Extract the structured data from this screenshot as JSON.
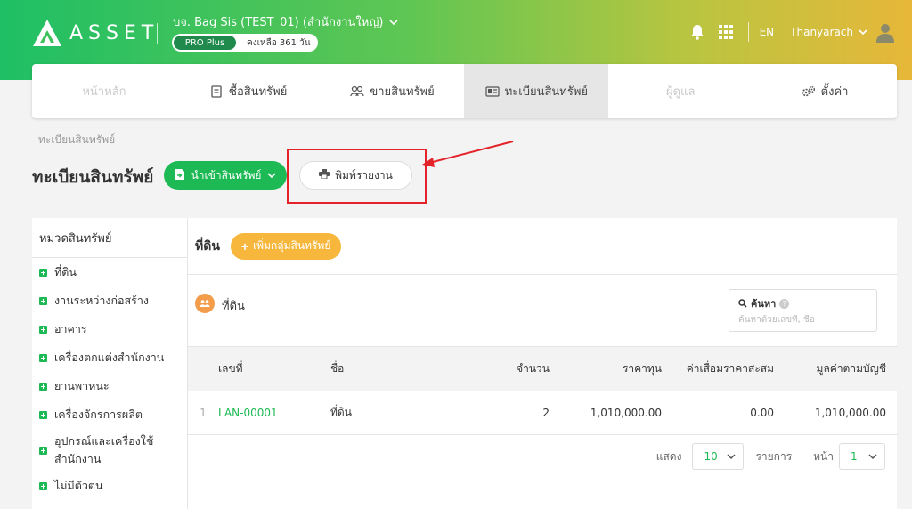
{
  "header": {
    "logo_text": "ASSET",
    "company": "บจ. Bag Sis (TEST_01) (สำนักงานใหญ่)",
    "plan": "PRO Plus",
    "remaining": "คงเหลือ 361 วัน",
    "lang": "EN",
    "user": "Thanyarach"
  },
  "nav": {
    "items": [
      {
        "label": "หน้าหลัก",
        "icon": "home"
      },
      {
        "label": "ซื้อสินทรัพย์",
        "icon": "buy-icon"
      },
      {
        "label": "ขายสินทรัพย์",
        "icon": "sell-icon"
      },
      {
        "label": "ทะเบียนสินทรัพย์",
        "icon": "register-icon"
      },
      {
        "label": "ผู้ดูแล",
        "icon": ""
      },
      {
        "label": "ตั้งค่า",
        "icon": "gear-icon"
      }
    ]
  },
  "breadcrumb": "ทะเบียนสินทรัพย์",
  "page": {
    "title": "ทะเบียนสินทรัพย์",
    "import_label": "นำเข้าสินทรัพย์",
    "print_label": "พิมพ์รายงาน"
  },
  "categories": {
    "title": "หมวดสินทรัพย์",
    "items": [
      "ที่ดิน",
      "งานระหว่างก่อสร้าง",
      "อาคาร",
      "เครื่องตกแต่งสำนักงาน",
      "ยานพาหนะ",
      "เครื่องจักรการผลิต",
      "อุปกรณ์และเครื่องใช้สำนักงาน",
      "ไม่มีตัวตน"
    ]
  },
  "main": {
    "group_title": "ที่ดิน",
    "add_group_label": "เพิ่มกลุ่มสินทรัพย์",
    "sub_title": "ที่ดิน",
    "search_label": "ค้นหา",
    "search_placeholder": "ค้นหาด้วยเลขที่, ชื่อ",
    "columns": {
      "no": "เลขที่",
      "name": "ชื่อ",
      "qty": "จำนวน",
      "cost": "ราคาทุน",
      "dep": "ค่าเสื่อมราคาสะสม",
      "book": "มูลค่าตามบัญชี"
    },
    "rows": [
      {
        "idx": "1",
        "no": "LAN-00001",
        "name": "ที่ดิน",
        "qty": "2",
        "cost": "1,010,000.00",
        "dep": "0.00",
        "book": "1,010,000.00"
      }
    ],
    "pager": {
      "show_label": "แสดง",
      "page_size": "10",
      "items_label": "รายการ",
      "page_label": "หน้า",
      "page": "1"
    }
  },
  "colors": {
    "accent_green": "#1db954",
    "accent_orange": "#f6b73c",
    "highlight_red": "#e3222a"
  }
}
